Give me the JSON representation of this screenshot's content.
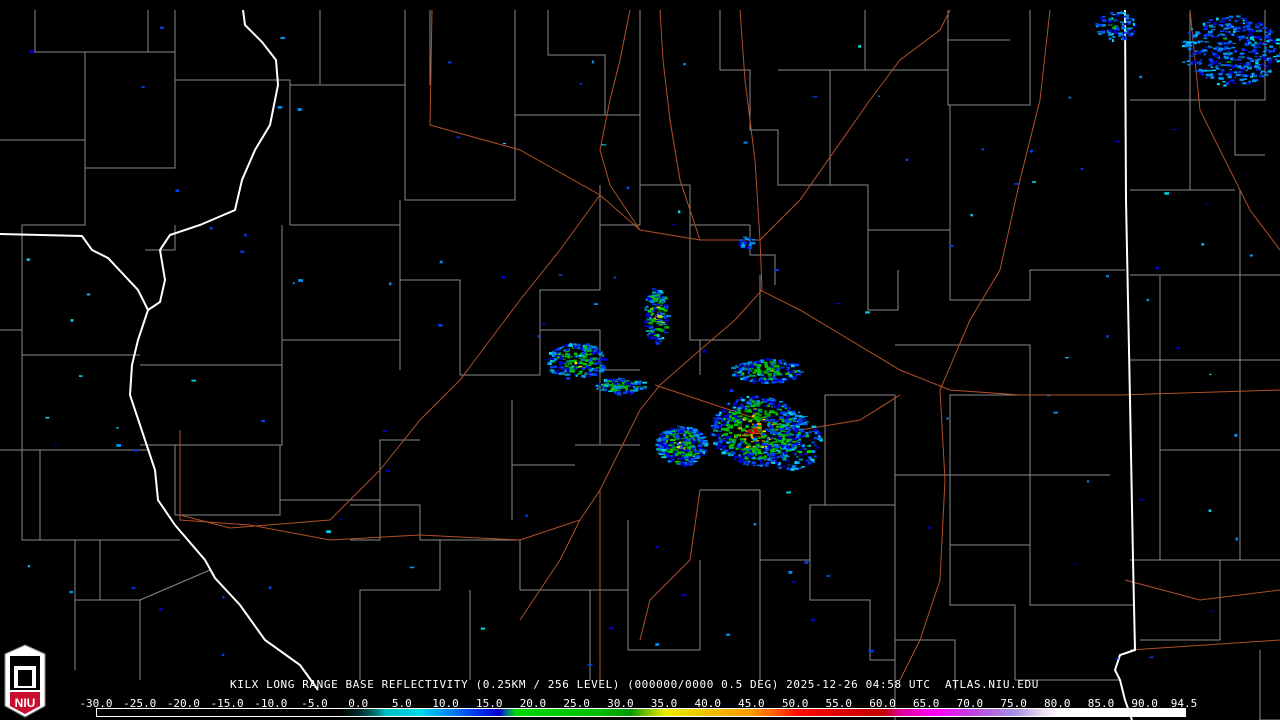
{
  "product_title": "KILX LONG RANGE BASE REFLECTIVITY (0.25KM / 256 LEVEL) (000000/0000 0.5 DEG) 2025-12-26 04:58 UTC  ATLAS.NIU.EDU",
  "logo": {
    "text": "NIU",
    "icon": "niu-tower-logo"
  },
  "colorbar": {
    "labels": [
      "-30.0",
      "-25.0",
      "-20.0",
      "-15.0",
      "-10.0",
      "-5.0",
      "0.0",
      "5.0",
      "10.0",
      "15.0",
      "20.0",
      "25.0",
      "30.0",
      "35.0",
      "40.0",
      "45.0",
      "50.0",
      "55.0",
      "60.0",
      "65.0",
      "70.0",
      "75.0",
      "80.0",
      "85.0",
      "90.0",
      "94.5"
    ],
    "min": -30,
    "max": 94.5,
    "stops": [
      [
        -30,
        "#000000"
      ],
      [
        -2,
        "#000000"
      ],
      [
        0,
        "#002a2e"
      ],
      [
        2,
        "#007a7a"
      ],
      [
        3,
        "#00c0c0"
      ],
      [
        7,
        "#00d8f0"
      ],
      [
        10,
        "#0090f0"
      ],
      [
        13,
        "#0040f0"
      ],
      [
        16,
        "#0000d0"
      ],
      [
        17,
        "#008080"
      ],
      [
        18,
        "#00d800"
      ],
      [
        27,
        "#00c000"
      ],
      [
        31,
        "#009800"
      ],
      [
        33,
        "#80c000"
      ],
      [
        35,
        "#e8f000"
      ],
      [
        40,
        "#f0c000"
      ],
      [
        45,
        "#ff9800"
      ],
      [
        48,
        "#ff5000"
      ],
      [
        50,
        "#ff1000"
      ],
      [
        55,
        "#e00000"
      ],
      [
        60,
        "#c40000"
      ],
      [
        62,
        "#e0009a"
      ],
      [
        66,
        "#ff00ff"
      ],
      [
        70,
        "#c040e0"
      ],
      [
        75,
        "#a890e0"
      ],
      [
        78,
        "#e8d8f0"
      ],
      [
        80,
        "#ffffff"
      ],
      [
        94.5,
        "#ffffff"
      ]
    ]
  },
  "colors": {
    "county": "#8a8a8a",
    "state": "#ffffff",
    "road": "#b05028"
  }
}
